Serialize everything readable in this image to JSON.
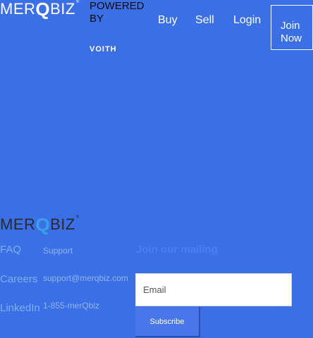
{
  "header": {
    "logo": {
      "part1": "MER",
      "q": "Q",
      "part2": "BIZ",
      "mark": "®"
    },
    "powered_by": "POWERED BY",
    "partner_logo": "VOITH",
    "nav": {
      "buy": "Buy",
      "sell": "Sell",
      "login": "Login",
      "join": "Join Now"
    }
  },
  "footer": {
    "logo": {
      "part1": "MER",
      "q": "Q",
      "part2": "BIZ",
      "mark": "®"
    },
    "links": {
      "faq": "FAQ",
      "careers": "Careers",
      "linkedin": "LinkedIn"
    },
    "support": {
      "label": "Support",
      "email": "support@merqbiz.com",
      "phone": "1-855-merQbiz"
    },
    "newsletter": {
      "title": "Join our mailing",
      "email_placeholder": "Email",
      "subscribe_label": "Subscribe"
    }
  },
  "colors": {
    "background": "#3b6fe6",
    "logo_q_accent": "#3aa0e8",
    "button": "#4a76ec"
  }
}
